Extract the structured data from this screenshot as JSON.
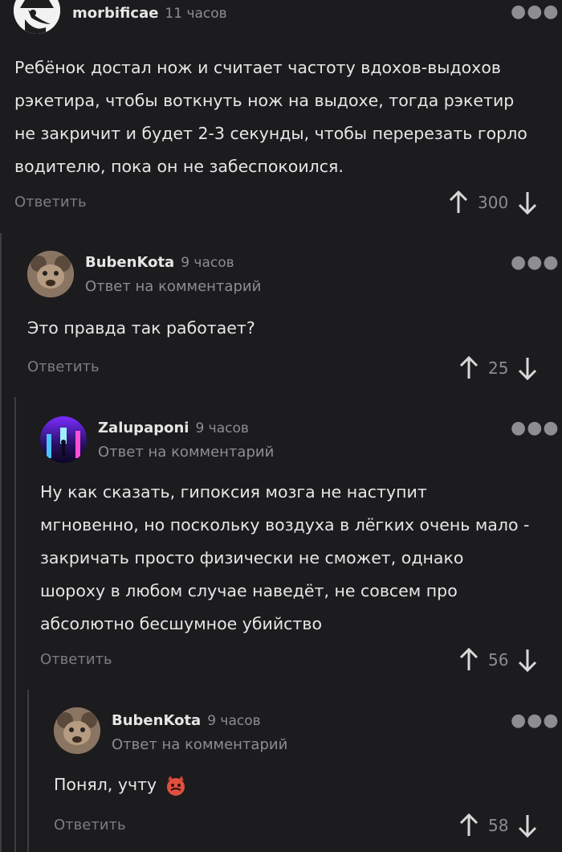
{
  "comments": [
    {
      "author": "morbificae",
      "time": "11 часов",
      "reply_note": "",
      "text": "Ребёнок достал нож и считает частоту вдохов-выдохов рэкетира, чтобы воткнуть нож на выдохе, тогда рэкетир не закричит и будет 2-3 секунды, чтобы перерезать горло водителю, пока он не забеспокоился.",
      "reply_label": "Ответить",
      "score": "300",
      "avatar_icon": "plague-doctor-avatar"
    },
    {
      "author": "BubenKota",
      "time": "9 часов",
      "reply_note": "Ответ на комментарий",
      "text": "Это правда так работает?",
      "reply_label": "Ответить",
      "score": "25",
      "avatar_icon": "rat-avatar"
    },
    {
      "author": "Zalupaponi",
      "time": "9 часов",
      "reply_note": "Ответ на комментарий",
      "text": "Ну как сказать, гипоксия мозга не наступит мгновенно, но поскольку воздуха в лёгких очень мало - закричать просто физически не сможет, однако шороху в любом случае наведёт, не совсем про абсолютно бесшумное убийство",
      "reply_label": "Ответить",
      "score": "56",
      "avatar_icon": "neon-city-avatar"
    },
    {
      "author": "BubenKota",
      "time": "9 часов",
      "reply_note": "Ответ на комментарий",
      "text": "Понял, учту",
      "emoji": "devil-emoji",
      "reply_label": "Ответить",
      "score": "58",
      "avatar_icon": "rat-avatar"
    }
  ],
  "colors": {
    "background": "#1c1c1e",
    "text": "#e6e6e6",
    "muted": "#8d8d92",
    "thread_line": "#3e3e41"
  },
  "icons": {
    "more": "more-dots-icon",
    "upvote": "arrow-up-icon",
    "downvote": "arrow-down-icon"
  }
}
